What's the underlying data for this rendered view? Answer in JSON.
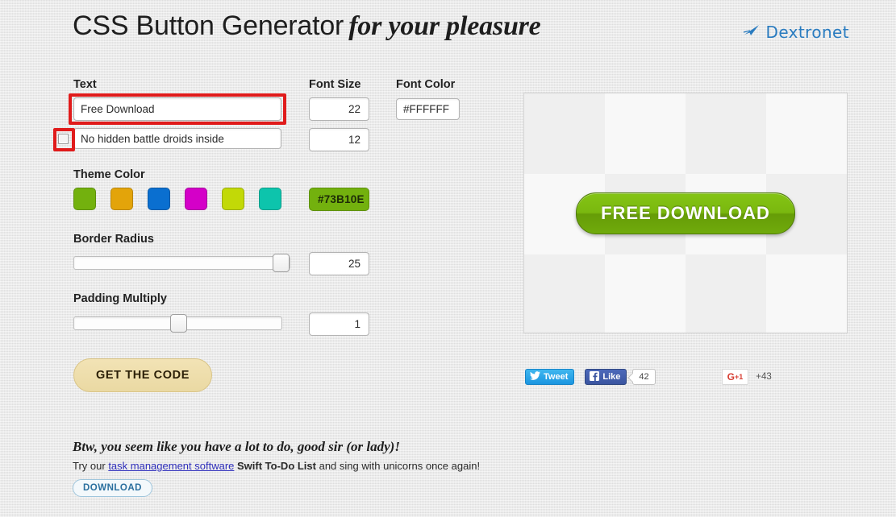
{
  "header": {
    "title_regular": "CSS Button Generator",
    "title_fancy": "for your pleasure",
    "brand_name": "Dextronet",
    "brand_icon": "arrow-swoosh-icon",
    "brand_color": "#2a7cc0"
  },
  "form": {
    "text_label": "Text",
    "text_value": "Free Download",
    "subtext_value": "No hidden battle droids inside",
    "subtext_checkbox_checked": false,
    "font_size_label": "Font Size",
    "font_size_value": "22",
    "font_size_small_value": "12",
    "font_color_label": "Font Color",
    "font_color_value": "#FFFFFF",
    "theme_color_label": "Theme Color",
    "theme_hex_value": "#73B10E",
    "swatches": [
      {
        "name": "green",
        "hex": "#73B10E"
      },
      {
        "name": "gold",
        "hex": "#E3A40A"
      },
      {
        "name": "blue",
        "hex": "#0A6FD0"
      },
      {
        "name": "magenta",
        "hex": "#D400C8"
      },
      {
        "name": "yellowgreen",
        "hex": "#C2D907"
      },
      {
        "name": "teal",
        "hex": "#0DC4AC"
      }
    ],
    "border_radius_label": "Border Radius",
    "border_radius_value": "25",
    "border_radius_percent": 100,
    "padding_multiply_label": "Padding Multiply",
    "padding_multiply_value": "1",
    "padding_multiply_percent": 50,
    "get_code_label": "GET THE CODE"
  },
  "preview": {
    "button_label": "FREE DOWNLOAD",
    "button_color": "#73B10E",
    "button_text_color": "#FFFFFF"
  },
  "social": {
    "tweet_label": "Tweet",
    "tweet_icon": "twitter-bird-icon",
    "like_label": "Like",
    "like_icon": "facebook-f-icon",
    "like_count": "42",
    "gplus_label": "G",
    "gplus_sup": "+1",
    "gplus_count": "+43"
  },
  "footer": {
    "headline": "Btw, you seem like you have a lot to do, good sir (or lady)!",
    "line_pre": "Try our ",
    "link_text": "task management software",
    "line_mid": " ",
    "product": "Swift To-Do List",
    "line_post": " and sing with unicorns once again!",
    "download_label": "DOWNLOAD"
  }
}
